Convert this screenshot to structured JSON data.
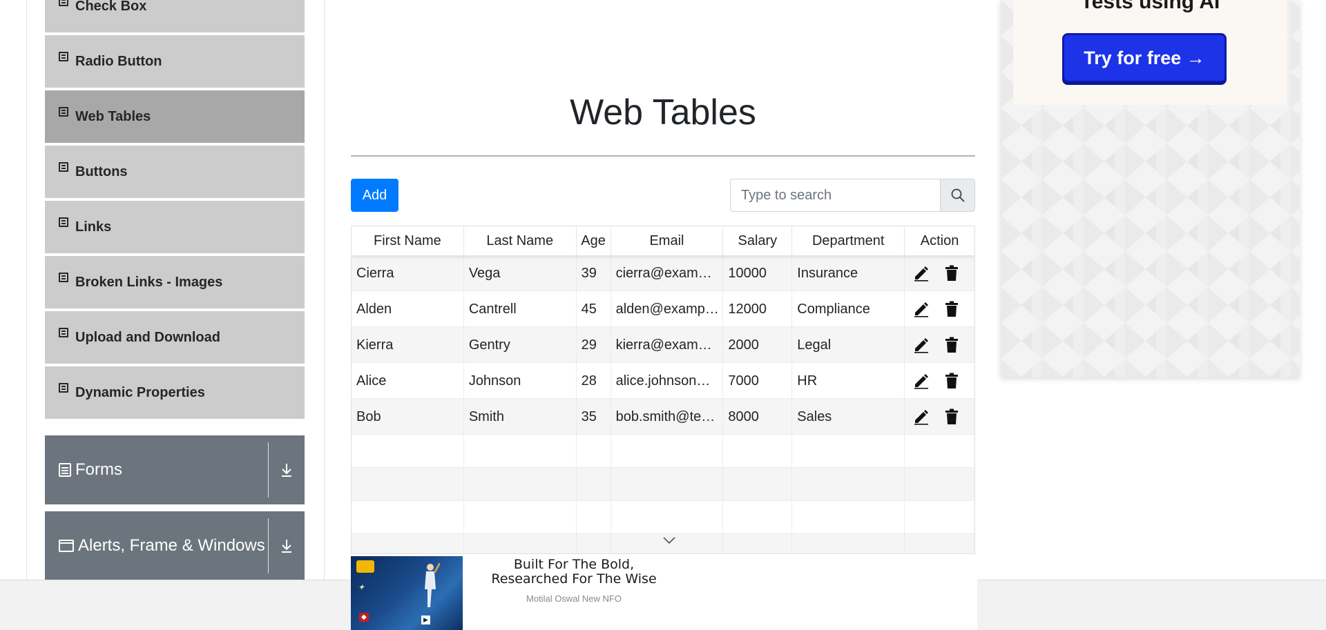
{
  "sidebar": {
    "element_items": [
      {
        "label": "Check Box"
      },
      {
        "label": "Radio Button"
      },
      {
        "label": "Web Tables"
      },
      {
        "label": "Buttons"
      },
      {
        "label": "Links"
      },
      {
        "label": "Broken Links - Images"
      },
      {
        "label": "Upload and Download"
      },
      {
        "label": "Dynamic Properties"
      }
    ],
    "active_item": "Web Tables",
    "groups": [
      {
        "label": "Forms",
        "icon": "form-icon"
      },
      {
        "label": "Alerts, Frame & Windows",
        "icon": "window-icon"
      }
    ]
  },
  "main": {
    "title": "Web Tables",
    "add_label": "Add",
    "search": {
      "placeholder": "Type to search",
      "value": ""
    },
    "table": {
      "headers": [
        "First Name",
        "Last Name",
        "Age",
        "Email",
        "Salary",
        "Department",
        "Action"
      ],
      "rows": [
        {
          "first": "Cierra",
          "last": "Vega",
          "age": "39",
          "email": "cierra@exampl...",
          "salary": "10000",
          "department": "Insurance"
        },
        {
          "first": "Alden",
          "last": "Cantrell",
          "age": "45",
          "email": "alden@exampl...",
          "salary": "12000",
          "department": "Compliance"
        },
        {
          "first": "Kierra",
          "last": "Gentry",
          "age": "29",
          "email": "kierra@exampl...",
          "salary": "2000",
          "department": "Legal"
        },
        {
          "first": "Alice",
          "last": "Johnson",
          "age": "28",
          "email": "alice.johnson@...",
          "salary": "7000",
          "department": "HR"
        },
        {
          "first": "Bob",
          "last": "Smith",
          "age": "35",
          "email": "bob.smith@tes...",
          "salary": "8000",
          "department": "Sales"
        }
      ],
      "empty_rows": 4
    }
  },
  "right_ad": {
    "headline": "Tests using AI",
    "cta": "Try for free →"
  },
  "bottom_ad": {
    "headline_line1": "Built For The Bold,",
    "headline_line2": "Researched For The Wise",
    "sponsor": "Motilal Oswal New NFO"
  },
  "colors": {
    "primary": "#007bff",
    "sidebar_item": "#cccccc",
    "sidebar_active": "#a8a8a8",
    "group_header": "#6c757d",
    "cta_blue": "#1d33e8"
  }
}
